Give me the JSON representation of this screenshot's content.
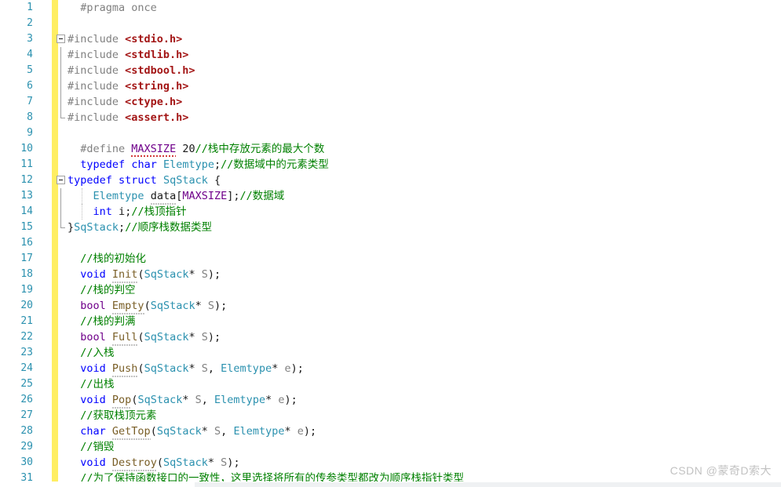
{
  "editor": {
    "language": "c-header",
    "colors": {
      "background": "#ffffff",
      "line_number": "#2b91af",
      "change_bar_yellow": "#ffee62",
      "preprocessor_gray": "#808080",
      "include_string_red": "#a31515",
      "keyword_blue": "#0000ff",
      "macro_purple": "#6f008a",
      "type_cyan": "#2b91af",
      "function_brown": "#795e26",
      "comment_green": "#008000",
      "parameter_gray": "#808080",
      "squiggle_red": "#cf2a2a",
      "watermark_gray": "#c2c2c2"
    },
    "first_visible_line": 1,
    "last_visible_line": 31,
    "total_visible_lines": 31,
    "lines": [
      {
        "n": "1",
        "fold": "none",
        "tokens": [
          {
            "text": "  ",
            "cls": "t-plain"
          },
          {
            "text": "#pragma once",
            "cls": "t-pp"
          }
        ]
      },
      {
        "n": "2",
        "fold": "none",
        "tokens": []
      },
      {
        "n": "3",
        "fold": "collapse-box",
        "tokens": [
          {
            "text": "#include ",
            "cls": "t-pp"
          },
          {
            "text": "<stdio.h>",
            "cls": "t-str"
          }
        ]
      },
      {
        "n": "4",
        "fold": "line",
        "tokens": [
          {
            "text": "#include ",
            "cls": "t-pp"
          },
          {
            "text": "<stdlib.h>",
            "cls": "t-str"
          }
        ]
      },
      {
        "n": "5",
        "fold": "line",
        "tokens": [
          {
            "text": "#include ",
            "cls": "t-pp"
          },
          {
            "text": "<stdbool.h>",
            "cls": "t-str"
          }
        ]
      },
      {
        "n": "6",
        "fold": "line",
        "tokens": [
          {
            "text": "#include ",
            "cls": "t-pp"
          },
          {
            "text": "<string.h>",
            "cls": "t-str"
          }
        ]
      },
      {
        "n": "7",
        "fold": "line",
        "tokens": [
          {
            "text": "#include ",
            "cls": "t-pp"
          },
          {
            "text": "<ctype.h>",
            "cls": "t-str"
          }
        ]
      },
      {
        "n": "8",
        "fold": "line-end",
        "tokens": [
          {
            "text": "#include ",
            "cls": "t-pp"
          },
          {
            "text": "<assert.h>",
            "cls": "t-str"
          }
        ]
      },
      {
        "n": "9",
        "fold": "none",
        "tokens": []
      },
      {
        "n": "10",
        "fold": "none",
        "tokens": [
          {
            "text": "  ",
            "cls": "t-plain"
          },
          {
            "text": "#define ",
            "cls": "t-pp"
          },
          {
            "text": "MAXSIZE",
            "cls": "t-macro",
            "squiggle": true
          },
          {
            "text": " 20",
            "cls": "t-num"
          },
          {
            "text": "//栈中存放元素的最大个数",
            "cls": "t-cmt"
          }
        ]
      },
      {
        "n": "11",
        "fold": "none",
        "tokens": [
          {
            "text": "  ",
            "cls": "t-plain"
          },
          {
            "text": "typedef",
            "cls": "t-kw"
          },
          {
            "text": " ",
            "cls": "t-plain"
          },
          {
            "text": "char",
            "cls": "t-kw"
          },
          {
            "text": " ",
            "cls": "t-plain"
          },
          {
            "text": "Elemtype",
            "cls": "t-type"
          },
          {
            "text": ";",
            "cls": "t-punc"
          },
          {
            "text": "//数据域中的元素类型",
            "cls": "t-cmt"
          }
        ]
      },
      {
        "n": "12",
        "fold": "collapse-box",
        "tokens": [
          {
            "text": "typedef",
            "cls": "t-kw"
          },
          {
            "text": " ",
            "cls": "t-plain"
          },
          {
            "text": "struct",
            "cls": "t-kw"
          },
          {
            "text": " ",
            "cls": "t-plain"
          },
          {
            "text": "SqStack",
            "cls": "t-type"
          },
          {
            "text": " {",
            "cls": "t-punc"
          }
        ]
      },
      {
        "n": "13",
        "fold": "line",
        "indent_guide": true,
        "tokens": [
          {
            "text": "    ",
            "cls": "t-plain"
          },
          {
            "text": "Elemtype",
            "cls": "t-type"
          },
          {
            "text": " ",
            "cls": "t-plain"
          },
          {
            "text": "data",
            "cls": "t-plain",
            "dotunder": true
          },
          {
            "text": "[",
            "cls": "t-punc"
          },
          {
            "text": "MAXSIZE",
            "cls": "t-macro"
          },
          {
            "text": "]",
            "cls": "t-punc"
          },
          {
            "text": ";",
            "cls": "t-punc"
          },
          {
            "text": "//数据域",
            "cls": "t-cmt"
          }
        ]
      },
      {
        "n": "14",
        "fold": "line",
        "indent_guide": true,
        "tokens": [
          {
            "text": "    ",
            "cls": "t-plain"
          },
          {
            "text": "int",
            "cls": "t-kw"
          },
          {
            "text": " ",
            "cls": "t-plain"
          },
          {
            "text": "i",
            "cls": "t-plain"
          },
          {
            "text": ";",
            "cls": "t-punc"
          },
          {
            "text": "//栈顶指针",
            "cls": "t-cmt"
          }
        ]
      },
      {
        "n": "15",
        "fold": "line-end",
        "tokens": [
          {
            "text": "}",
            "cls": "t-punc"
          },
          {
            "text": "SqStack",
            "cls": "t-type"
          },
          {
            "text": ";",
            "cls": "t-punc"
          },
          {
            "text": "//顺序栈数据类型",
            "cls": "t-cmt"
          }
        ]
      },
      {
        "n": "16",
        "fold": "none",
        "tokens": []
      },
      {
        "n": "17",
        "fold": "none",
        "tokens": [
          {
            "text": "  ",
            "cls": "t-plain"
          },
          {
            "text": "//栈的初始化",
            "cls": "t-cmt"
          }
        ]
      },
      {
        "n": "18",
        "fold": "none",
        "tokens": [
          {
            "text": "  ",
            "cls": "t-plain"
          },
          {
            "text": "void",
            "cls": "t-kw"
          },
          {
            "text": " ",
            "cls": "t-plain"
          },
          {
            "text": "Init",
            "cls": "t-fn",
            "dotunder": true
          },
          {
            "text": "(",
            "cls": "t-punc"
          },
          {
            "text": "SqStack",
            "cls": "t-type"
          },
          {
            "text": "*",
            "cls": "t-punc"
          },
          {
            "text": " ",
            "cls": "t-plain"
          },
          {
            "text": "S",
            "cls": "t-var"
          },
          {
            "text": ")",
            "cls": "t-punc"
          },
          {
            "text": ";",
            "cls": "t-punc"
          }
        ]
      },
      {
        "n": "19",
        "fold": "none",
        "tokens": [
          {
            "text": "  ",
            "cls": "t-plain"
          },
          {
            "text": "//栈的判空",
            "cls": "t-cmt"
          }
        ]
      },
      {
        "n": "20",
        "fold": "none",
        "tokens": [
          {
            "text": "  ",
            "cls": "t-plain"
          },
          {
            "text": "bool",
            "cls": "t-macro"
          },
          {
            "text": " ",
            "cls": "t-plain"
          },
          {
            "text": "Empty",
            "cls": "t-fn",
            "dotunder": true
          },
          {
            "text": "(",
            "cls": "t-punc"
          },
          {
            "text": "SqStack",
            "cls": "t-type"
          },
          {
            "text": "*",
            "cls": "t-punc"
          },
          {
            "text": " ",
            "cls": "t-plain"
          },
          {
            "text": "S",
            "cls": "t-var"
          },
          {
            "text": ")",
            "cls": "t-punc"
          },
          {
            "text": ";",
            "cls": "t-punc"
          }
        ]
      },
      {
        "n": "21",
        "fold": "none",
        "tokens": [
          {
            "text": "  ",
            "cls": "t-plain"
          },
          {
            "text": "//栈的判满",
            "cls": "t-cmt"
          }
        ]
      },
      {
        "n": "22",
        "fold": "none",
        "tokens": [
          {
            "text": "  ",
            "cls": "t-plain"
          },
          {
            "text": "bool",
            "cls": "t-macro"
          },
          {
            "text": " ",
            "cls": "t-plain"
          },
          {
            "text": "Full",
            "cls": "t-fn",
            "dotunder": true
          },
          {
            "text": "(",
            "cls": "t-punc"
          },
          {
            "text": "SqStack",
            "cls": "t-type"
          },
          {
            "text": "*",
            "cls": "t-punc"
          },
          {
            "text": " ",
            "cls": "t-plain"
          },
          {
            "text": "S",
            "cls": "t-var"
          },
          {
            "text": ")",
            "cls": "t-punc"
          },
          {
            "text": ";",
            "cls": "t-punc"
          }
        ]
      },
      {
        "n": "23",
        "fold": "none",
        "tokens": [
          {
            "text": "  ",
            "cls": "t-plain"
          },
          {
            "text": "//入栈",
            "cls": "t-cmt"
          }
        ]
      },
      {
        "n": "24",
        "fold": "none",
        "tokens": [
          {
            "text": "  ",
            "cls": "t-plain"
          },
          {
            "text": "void",
            "cls": "t-kw"
          },
          {
            "text": " ",
            "cls": "t-plain"
          },
          {
            "text": "Push",
            "cls": "t-fn",
            "dotunder": true
          },
          {
            "text": "(",
            "cls": "t-punc"
          },
          {
            "text": "SqStack",
            "cls": "t-type"
          },
          {
            "text": "*",
            "cls": "t-punc"
          },
          {
            "text": " ",
            "cls": "t-plain"
          },
          {
            "text": "S",
            "cls": "t-var"
          },
          {
            "text": ", ",
            "cls": "t-punc"
          },
          {
            "text": "Elemtype",
            "cls": "t-type"
          },
          {
            "text": "*",
            "cls": "t-punc"
          },
          {
            "text": " ",
            "cls": "t-plain"
          },
          {
            "text": "e",
            "cls": "t-var"
          },
          {
            "text": ")",
            "cls": "t-punc"
          },
          {
            "text": ";",
            "cls": "t-punc"
          }
        ]
      },
      {
        "n": "25",
        "fold": "none",
        "tokens": [
          {
            "text": "  ",
            "cls": "t-plain"
          },
          {
            "text": "//出栈",
            "cls": "t-cmt"
          }
        ]
      },
      {
        "n": "26",
        "fold": "none",
        "tokens": [
          {
            "text": "  ",
            "cls": "t-plain"
          },
          {
            "text": "void",
            "cls": "t-kw"
          },
          {
            "text": " ",
            "cls": "t-plain"
          },
          {
            "text": "Pop",
            "cls": "t-fn",
            "dotunder": true
          },
          {
            "text": "(",
            "cls": "t-punc"
          },
          {
            "text": "SqStack",
            "cls": "t-type"
          },
          {
            "text": "*",
            "cls": "t-punc"
          },
          {
            "text": " ",
            "cls": "t-plain"
          },
          {
            "text": "S",
            "cls": "t-var"
          },
          {
            "text": ", ",
            "cls": "t-punc"
          },
          {
            "text": "Elemtype",
            "cls": "t-type"
          },
          {
            "text": "*",
            "cls": "t-punc"
          },
          {
            "text": " ",
            "cls": "t-plain"
          },
          {
            "text": "e",
            "cls": "t-var"
          },
          {
            "text": ")",
            "cls": "t-punc"
          },
          {
            "text": ";",
            "cls": "t-punc"
          }
        ]
      },
      {
        "n": "27",
        "fold": "none",
        "tokens": [
          {
            "text": "  ",
            "cls": "t-plain"
          },
          {
            "text": "//获取栈顶元素",
            "cls": "t-cmt"
          }
        ]
      },
      {
        "n": "28",
        "fold": "none",
        "tokens": [
          {
            "text": "  ",
            "cls": "t-plain"
          },
          {
            "text": "char",
            "cls": "t-kw"
          },
          {
            "text": " ",
            "cls": "t-plain"
          },
          {
            "text": "GetTop",
            "cls": "t-fn",
            "dotunder": true
          },
          {
            "text": "(",
            "cls": "t-punc"
          },
          {
            "text": "SqStack",
            "cls": "t-type"
          },
          {
            "text": "*",
            "cls": "t-punc"
          },
          {
            "text": " ",
            "cls": "t-plain"
          },
          {
            "text": "S",
            "cls": "t-var"
          },
          {
            "text": ", ",
            "cls": "t-punc"
          },
          {
            "text": "Elemtype",
            "cls": "t-type"
          },
          {
            "text": "*",
            "cls": "t-punc"
          },
          {
            "text": " ",
            "cls": "t-plain"
          },
          {
            "text": "e",
            "cls": "t-var"
          },
          {
            "text": ")",
            "cls": "t-punc"
          },
          {
            "text": ";",
            "cls": "t-punc"
          }
        ]
      },
      {
        "n": "29",
        "fold": "none",
        "tokens": [
          {
            "text": "  ",
            "cls": "t-plain"
          },
          {
            "text": "//销毁",
            "cls": "t-cmt"
          }
        ]
      },
      {
        "n": "30",
        "fold": "none",
        "tokens": [
          {
            "text": "  ",
            "cls": "t-plain"
          },
          {
            "text": "void",
            "cls": "t-kw"
          },
          {
            "text": " ",
            "cls": "t-plain"
          },
          {
            "text": "Destroy",
            "cls": "t-fn",
            "dotunder": true
          },
          {
            "text": "(",
            "cls": "t-punc"
          },
          {
            "text": "SqStack",
            "cls": "t-type"
          },
          {
            "text": "*",
            "cls": "t-punc"
          },
          {
            "text": " ",
            "cls": "t-plain"
          },
          {
            "text": "S",
            "cls": "t-var"
          },
          {
            "text": ")",
            "cls": "t-punc"
          },
          {
            "text": ";",
            "cls": "t-punc"
          }
        ]
      },
      {
        "n": "31",
        "fold": "none",
        "tokens": [
          {
            "text": "  ",
            "cls": "t-plain"
          },
          {
            "text": "//为了保持函数接口的一致性，这里选择将所有的传参类型都改为顺序栈指针类型",
            "cls": "t-cmt"
          }
        ]
      }
    ]
  },
  "watermark": {
    "text": "CSDN @蒙奇D索大"
  }
}
